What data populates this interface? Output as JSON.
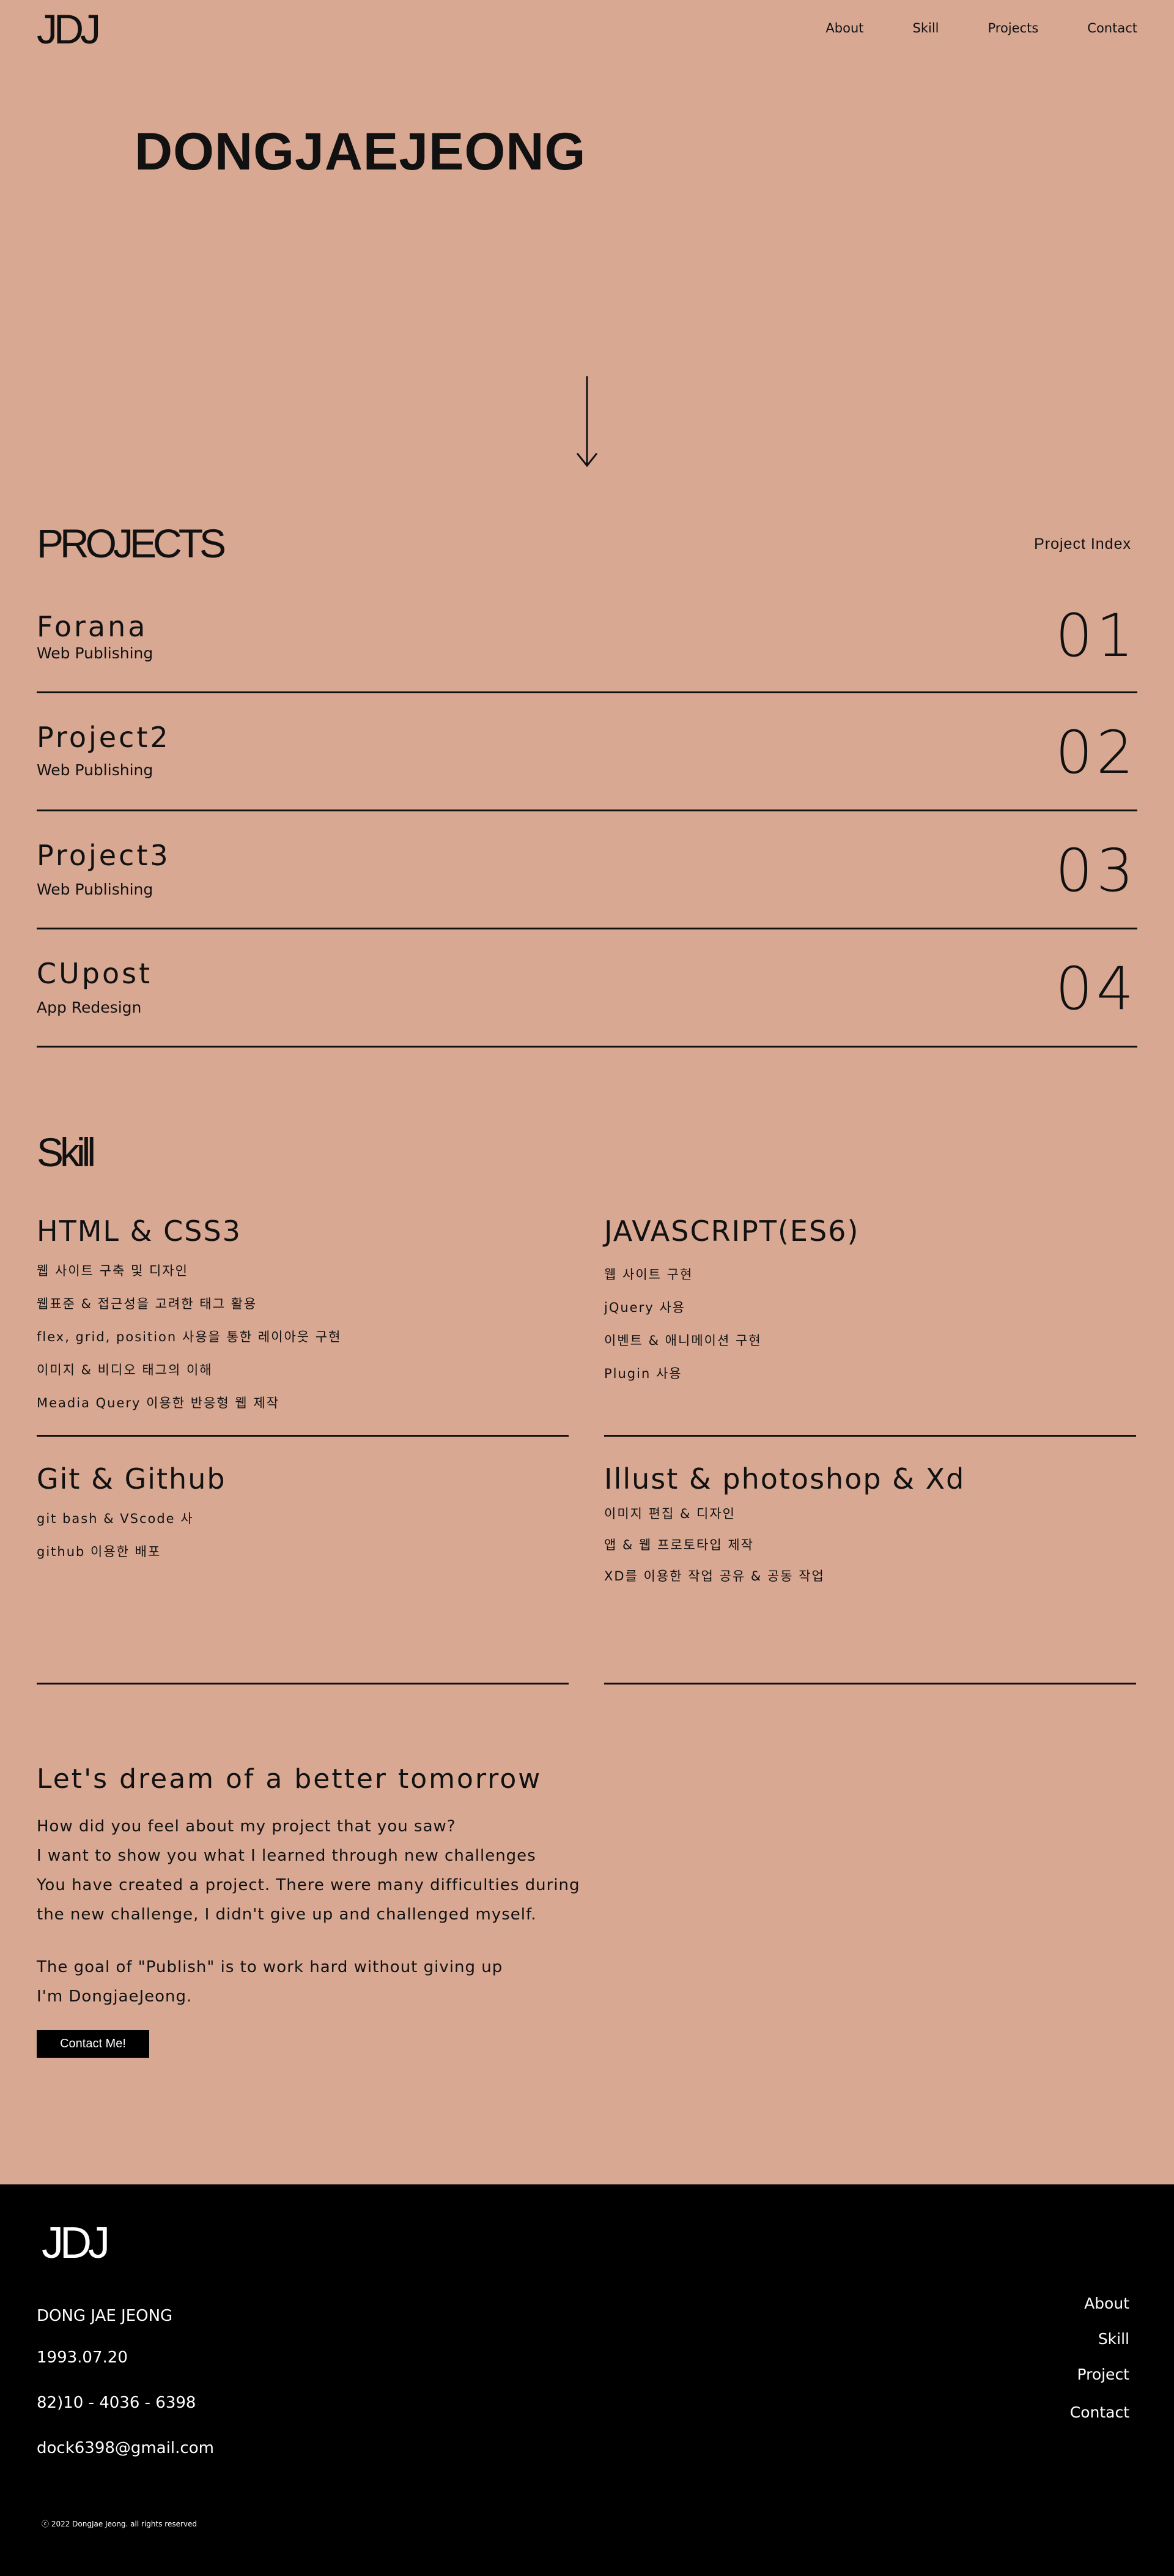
{
  "header": {
    "logo": "JDJ",
    "nav": [
      "About",
      "Skill",
      "Projects",
      "Contact"
    ]
  },
  "hero": {
    "name": "DONGJAEJEONG"
  },
  "projects": {
    "title": "PROJECTS",
    "index_link": "Project Index",
    "items": [
      {
        "name": "Forana",
        "category": "Web Publishing",
        "number": "01"
      },
      {
        "name": "Project2",
        "category": "Web Publishing",
        "number": "02"
      },
      {
        "name": "Project3",
        "category": "Web Publishing",
        "number": "03"
      },
      {
        "name": "CUpost",
        "category": "App Redesign",
        "number": "04"
      }
    ]
  },
  "skill": {
    "title": "Skill",
    "cards": [
      {
        "title": "HTML & CSS3",
        "items": [
          "웹 사이트 구축 및 디자인",
          "웹표준 & 접근성을 고려한 태그 활용",
          "flex, grid, position 사용을 통한 레이아웃 구현",
          "이미지 & 비디오 태그의 이해",
          "Meadia Query 이용한 반응형 웹 제작"
        ]
      },
      {
        "title": "JAVASCRIPT(ES6)",
        "items": [
          "웹 사이트 구현",
          "jQuery 사용",
          "이벤트 & 애니메이션 구현",
          "Plugin 사용"
        ]
      },
      {
        "title": "Git & Github",
        "items": [
          "git bash & VScode 사",
          "github 이용한 배포"
        ]
      },
      {
        "title": "Illust & photoshop & Xd",
        "items": [
          "이미지 편집 & 디자인",
          "앱 & 웹 프로토타입 제작",
          "XD를 이용한 작업 공유 & 공동 작업"
        ]
      }
    ]
  },
  "contact": {
    "heading": "Let's dream of a better tomorrow",
    "lines": [
      "How did you feel about my project that you saw?",
      "I want to show you what I learned through new challenges",
      "You have created a project. There were many difficulties during",
      "the new challenge, I didn't give up and challenged myself.",
      "The goal of \"Publish\" is to work hard without giving up",
      "I'm DongjaeJeong."
    ],
    "button": "Contact Me!"
  },
  "footer": {
    "logo": "JDJ",
    "name": "DONG JAE JEONG",
    "birth": "1993.07.20",
    "phone": "82)10 - 4036 - 6398",
    "email": "dock6398@gmail.com",
    "nav": [
      "About",
      "Skill",
      "Project",
      "Contact"
    ],
    "copyright": "ⓒ 2022 DongJae Jeong. all rights reserved"
  },
  "colors": {
    "background": "#d8a893",
    "text": "#111111",
    "footer": "#000000"
  }
}
